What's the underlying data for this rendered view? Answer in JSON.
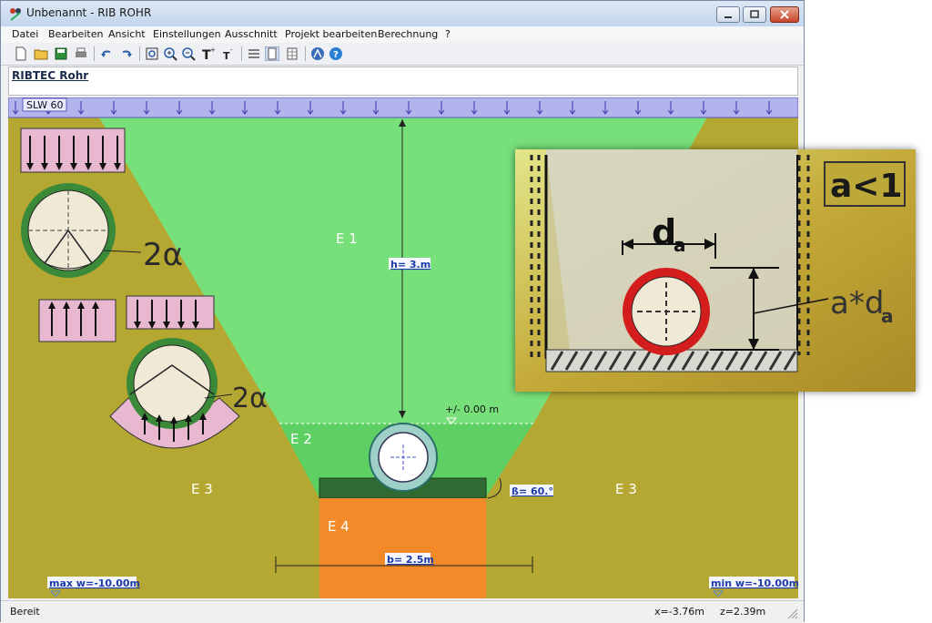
{
  "window": {
    "title": "Unbenannt - RIB ROHR"
  },
  "menu": [
    "Datei",
    "Bearbeiten",
    "Ansicht",
    "Einstellungen",
    "Ausschnitt",
    "Projekt bearbeiten",
    "Berechnung",
    "?"
  ],
  "toolbar": {
    "icons": [
      "new-file-icon",
      "open-folder-icon",
      "save-icon",
      "print-icon",
      "undo-icon",
      "redo-icon",
      "zoom-fit-icon",
      "zoom-in-icon",
      "zoom-out-icon",
      "font-larger-icon",
      "font-smaller-icon",
      "list-view-icon",
      "page-view-icon",
      "table-view-icon",
      "rib-logo-icon",
      "help-icon"
    ]
  },
  "header": {
    "brand": "RIBTEC Rohr"
  },
  "drawing": {
    "load_label": "SLW 60",
    "zones": {
      "e1": "E 1",
      "e2": "E 2",
      "e3_left": "E 3",
      "e3_right": "E 3",
      "e4": "E 4"
    },
    "height_label": "h= 3.m",
    "width_label": "b= 2.5m",
    "angle_label": "ß= 60.°",
    "level_label": "+/- 0.00 m",
    "max_w_label": "max w=-10.00m",
    "min_w_label": "min w=-10.00m",
    "alpha_label_1": "2α",
    "alpha_label_2": "2α",
    "colors": {
      "fill_green": "#77e07a",
      "bedding_green": "#5ecf62",
      "soil_olive": "#b5a832",
      "sole_orange": "#f28a2a",
      "bed_dark": "#2e6a32",
      "load_band": "#b3b4ee",
      "pipe_ring": "#9ed0c8"
    }
  },
  "inset": {
    "ratio_label": "a<1",
    "diameter_label": "d",
    "diameter_sub": "a",
    "height_label": "a*d",
    "height_sub": "a"
  },
  "status": {
    "text": "Bereit",
    "x": "x=-3.76m",
    "z": "z=2.39m"
  }
}
